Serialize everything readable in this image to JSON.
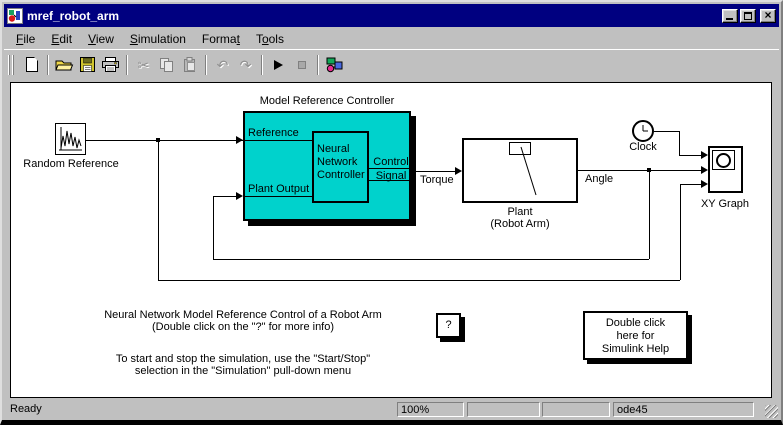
{
  "window": {
    "title": "mref_robot_arm",
    "close_glyph": "×"
  },
  "menu": {
    "items": [
      {
        "pre": "",
        "key": "F",
        "post": "ile"
      },
      {
        "pre": "",
        "key": "E",
        "post": "dit"
      },
      {
        "pre": "",
        "key": "V",
        "post": "iew"
      },
      {
        "pre": "",
        "key": "S",
        "post": "imulation"
      },
      {
        "pre": "Forma",
        "key": "t",
        "post": ""
      },
      {
        "pre": "T",
        "key": "o",
        "post": "ols"
      }
    ]
  },
  "toolbar": {
    "buttons": [
      "new",
      "open",
      "save",
      "print",
      "cut",
      "copy",
      "paste",
      "undo",
      "redo",
      "start-simulation",
      "stop-simulation",
      "library-browser"
    ],
    "cut_glyph": "✂",
    "copy_glyph": "⎘",
    "undo_glyph": "↶",
    "redo_glyph": "↷"
  },
  "diagram": {
    "random_reference": {
      "label": "Random Reference"
    },
    "controller": {
      "title": "Model Reference Controller",
      "port_reference": "Reference",
      "port_plant_output": "Plant Output",
      "inner_block": {
        "line1": "Neural",
        "line2": "Network",
        "line3": "Controller"
      },
      "port_out_line1": "Control",
      "port_out_line2": "Signal"
    },
    "signal_torque": "Torque",
    "plant": {
      "label_line1": "Plant",
      "label_line2": "(Robot Arm)"
    },
    "signal_angle": "Angle",
    "clock": {
      "label": "Clock"
    },
    "xy_graph": {
      "label": "XY Graph"
    },
    "question_block": {
      "label": "?"
    },
    "help_block": {
      "line1": "Double click",
      "line2": "here for",
      "line3": "Simulink Help"
    },
    "annotation_top": {
      "line1": "Neural Network Model Reference Control of a Robot Arm",
      "line2": "(Double click on the \"?\" for more info)"
    },
    "annotation_bottom": {
      "line1": "To start and stop the simulation, use the \"Start/Stop\"",
      "line2": "selection in the \"Simulation\" pull-down menu"
    }
  },
  "statusbar": {
    "ready": "Ready",
    "zoom": "100%",
    "panel2": "",
    "panel3": "",
    "solver": "ode45"
  },
  "colors": {
    "titlebar": "#000080",
    "block_fill": "#00d2cc",
    "chrome": "#c0c0c0",
    "canvas": "#ffffff"
  }
}
